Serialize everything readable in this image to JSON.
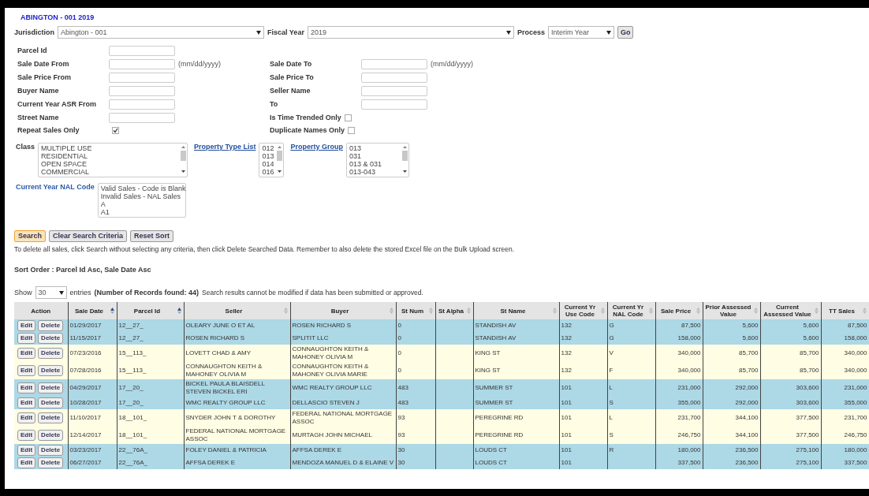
{
  "title": "ABINGTON - 001 2019",
  "selectors": [
    {
      "label": "Jurisdiction",
      "value": "Abington - 001"
    },
    {
      "label": "Fiscal Year",
      "value": "2019"
    },
    {
      "label": "Process",
      "value": "Interim Year"
    }
  ],
  "go_button": "Go",
  "field_rows": [
    {
      "left": {
        "kind": "text",
        "label": "Parcel Id"
      }
    },
    {
      "left": {
        "kind": "text",
        "label": "Sale Date From",
        "hint": "(mm/dd/yyyy)"
      },
      "right": {
        "kind": "text",
        "label": "Sale Date To",
        "hint": "(mm/dd/yyyy)"
      }
    },
    {
      "left": {
        "kind": "text",
        "label": "Sale Price From"
      },
      "right": {
        "kind": "text",
        "label": "Sale Price To"
      }
    },
    {
      "left": {
        "kind": "text",
        "label": "Buyer Name"
      },
      "right": {
        "kind": "text",
        "label": "Seller Name"
      }
    },
    {
      "left": {
        "kind": "text",
        "label": "Current Year ASR From"
      },
      "right": {
        "kind": "text",
        "label": "To"
      }
    },
    {
      "left": {
        "kind": "text",
        "label": "Street Name"
      },
      "right": {
        "kind": "checkbox",
        "label": "Is Time Trended Only",
        "checked": false
      }
    },
    {
      "left": {
        "kind": "checkbox",
        "label": "Repeat Sales Only",
        "checked": true
      },
      "right": {
        "kind": "checkbox",
        "label": "Duplicate Names Only",
        "checked": false
      }
    }
  ],
  "listboxes": [
    {
      "label": "Class",
      "kind": "plain",
      "options": [
        "MULTIPLE USE",
        "RESIDENTIAL",
        "OPEN SPACE",
        "COMMERCIAL"
      ]
    },
    {
      "label": "Property Type List",
      "kind": "link",
      "options": [
        "012",
        "013",
        "014",
        "016"
      ]
    },
    {
      "label": "Property Group",
      "kind": "link",
      "options": [
        "013",
        "031",
        "013 & 031",
        "013-043"
      ]
    }
  ],
  "nal_listbox": {
    "label": "Current Year NAL Code",
    "kind": "accent",
    "options": [
      "Valid Sales - Code is Blank",
      "Invalid Sales - NAL Sales",
      "A",
      "A1"
    ]
  },
  "buttons": [
    {
      "label": "Search",
      "focused": true
    },
    {
      "label": "Clear Search Criteria",
      "focused": false
    },
    {
      "label": "Reset Sort",
      "focused": false
    }
  ],
  "note": "To delete all sales, click Search without selecting any criteria, then click Delete Searched Data. Remember to also delete the stored Excel file on the Bulk Upload screen.",
  "sort_order": "Sort Order : Parcel Id Asc, Sale Date Asc",
  "show": {
    "label": "Show",
    "value": "30",
    "suffix": "entries",
    "records": "(Number of Records found: 44)",
    "message": "Search results cannot be modified if data has been submitted or approved."
  },
  "table": {
    "columns": [
      {
        "label": "Action"
      },
      {
        "label": "Sale Date",
        "sorted": true
      },
      {
        "label": "Parcel Id",
        "sorted": true
      },
      {
        "label": "Seller",
        "sorted": false
      },
      {
        "label": "Buyer",
        "sorted": false
      },
      {
        "label": "St Num",
        "sorted": false
      },
      {
        "label": "St Alpha",
        "sorted": false
      },
      {
        "label": "St Name",
        "sorted": false
      },
      {
        "label": "Current Yr Use Code",
        "sorted": false
      },
      {
        "label": "Current Yr NAL Code",
        "sorted": false
      },
      {
        "label": "Sale Price",
        "sorted": false
      },
      {
        "label": "Prior Assessed Value",
        "sorted": false
      },
      {
        "label": "Current Assessed Value",
        "sorted": false
      },
      {
        "label": "TT Sales",
        "sorted": false
      }
    ],
    "rows": [
      {
        "color": "#add8e6",
        "actions": [
          "Edit",
          "Delete"
        ],
        "sale_date": "01/29/2017",
        "parcel_id": "12__27_",
        "seller": "OLEARY JUNE O ET AL",
        "buyer": "ROSEN RICHARD S",
        "st_num": "0",
        "st_name": "STANDISH AV",
        "use_code": "132",
        "nal_code": "G",
        "sale_price": "87,500",
        "prior_assessed": "5,600",
        "current_assessed": "5,600",
        "tt_sales": "87,500"
      },
      {
        "color": "#add8e6",
        "actions": [
          "Edit",
          "Delete"
        ],
        "sale_date": "11/15/2017",
        "parcel_id": "12__27_",
        "seller": "ROSEN RICHARD S",
        "buyer": "SPLITIT LLC",
        "st_num": "0",
        "st_name": "STANDISH AV",
        "use_code": "132",
        "nal_code": "G",
        "sale_price": "158,000",
        "prior_assessed": "5,600",
        "current_assessed": "5,600",
        "tt_sales": "158,000"
      },
      {
        "color": "#fffde3",
        "actions": [
          "Edit",
          "Delete"
        ],
        "sale_date": "07/23/2016",
        "parcel_id": "15__113_",
        "seller": "LOVETT CHAD & AMY",
        "buyer": "CONNAUGHTON KEITH & MAHONEY OLIVIA M",
        "st_num": "0",
        "st_name": "KING ST",
        "use_code": "132",
        "nal_code": "V",
        "sale_price": "340,000",
        "prior_assessed": "85,700",
        "current_assessed": "85,700",
        "tt_sales": "340,000"
      },
      {
        "color": "#fffde3",
        "actions": [
          "Edit",
          "Delete"
        ],
        "sale_date": "07/28/2016",
        "parcel_id": "15__113_",
        "seller": "CONNAUGHTON KEITH & MAHONEY OLIVIA M",
        "buyer": "CONNAUGHTON KEITH & MAHONEY OLIVIA MARIE",
        "st_num": "0",
        "st_name": "KING ST",
        "use_code": "132",
        "nal_code": "F",
        "sale_price": "340,000",
        "prior_assessed": "85,700",
        "current_assessed": "85,700",
        "tt_sales": "340,000"
      },
      {
        "color": "#add8e6",
        "actions": [
          "Edit",
          "Delete"
        ],
        "sale_date": "04/29/2017",
        "parcel_id": "17__20_",
        "seller": "BICKEL PAULA BLAISDELL STEVEN BICKEL ERI",
        "buyer": "WMC REALTY GROUP LLC",
        "st_num": "483",
        "st_name": "SUMMER ST",
        "use_code": "101",
        "nal_code": "L",
        "sale_price": "231,000",
        "prior_assessed": "292,000",
        "current_assessed": "303,600",
        "tt_sales": "231,000"
      },
      {
        "color": "#add8e6",
        "actions": [
          "Edit",
          "Delete"
        ],
        "sale_date": "10/28/2017",
        "parcel_id": "17__20_",
        "seller": "WMC REALTY GROUP LLC",
        "buyer": "DELLASCIO STEVEN J",
        "st_num": "483",
        "st_name": "SUMMER ST",
        "use_code": "101",
        "nal_code": "S",
        "sale_price": "355,000",
        "prior_assessed": "292,000",
        "current_assessed": "303,600",
        "tt_sales": "355,000"
      },
      {
        "color": "#fffde3",
        "actions": [
          "Edit",
          "Delete"
        ],
        "sale_date": "11/10/2017",
        "parcel_id": "18__101_",
        "seller": "SNYDER JOHN T & DOROTHY",
        "buyer": "FEDERAL NATIONAL MORTGAGE ASSOC",
        "st_num": "93",
        "st_name": "PEREGRINE RD",
        "use_code": "101",
        "nal_code": "L",
        "sale_price": "231,700",
        "prior_assessed": "344,100",
        "current_assessed": "377,500",
        "tt_sales": "231,700"
      },
      {
        "color": "#fffde3",
        "actions": [
          "Edit",
          "Delete"
        ],
        "sale_date": "12/14/2017",
        "parcel_id": "18__101_",
        "seller": "FEDERAL NATIONAL MORTGAGE ASSOC",
        "buyer": "MURTAGH JOHN MICHAEL",
        "st_num": "93",
        "st_name": "PEREGRINE RD",
        "use_code": "101",
        "nal_code": "S",
        "sale_price": "246,750",
        "prior_assessed": "344,100",
        "current_assessed": "377,500",
        "tt_sales": "246,750"
      },
      {
        "color": "#add8e6",
        "actions": [
          "Edit",
          "Delete"
        ],
        "sale_date": "03/23/2017",
        "parcel_id": "22__76A_",
        "seller": "FOLEY DANIEL & PATRICIA",
        "buyer": "AFFSA DEREK E",
        "st_num": "30",
        "st_name": "LOUDS CT",
        "use_code": "101",
        "nal_code": "R",
        "sale_price": "180,000",
        "prior_assessed": "236,500",
        "current_assessed": "275,100",
        "tt_sales": "180,000"
      },
      {
        "color": "#add8e6",
        "actions": [
          "Edit",
          "Delete"
        ],
        "sale_date": "06/27/2017",
        "parcel_id": "22__76A_",
        "seller": "AFFSA DEREK E",
        "buyer": "MENDOZA MANUEL D & ELAINE V",
        "st_num": "30",
        "st_name": "LOUDS CT",
        "use_code": "101",
        "sale_price": "337,500",
        "prior_assessed": "236,500",
        "current_assessed": "275,100",
        "tt_sales": "337,500"
      }
    ]
  }
}
